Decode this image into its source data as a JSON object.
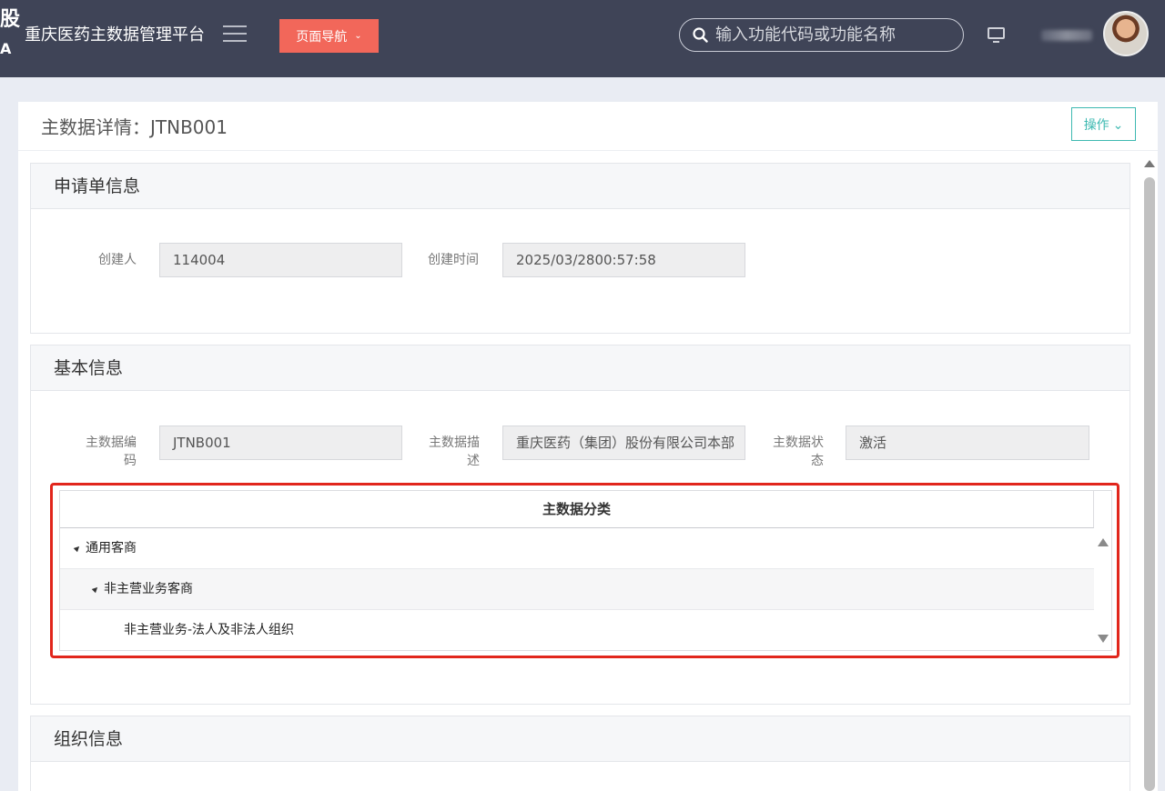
{
  "header": {
    "logo_top": "股",
    "logo_bottom": "A",
    "app_title": "重庆医药主数据管理平台",
    "nav_button_label": "页面导航",
    "search_placeholder": "输入功能代码或功能名称"
  },
  "page": {
    "title": "主数据详情：JTNB001",
    "action_button": "操作"
  },
  "sections": {
    "application": {
      "title": "申请单信息",
      "creator_label": "创建人",
      "creator_value": "114004",
      "created_time_label": "创建时间",
      "created_time_value": "2025/03/2800:57:58"
    },
    "basic": {
      "title": "基本信息",
      "code_label_line1": "主数据编",
      "code_label_line2": "码",
      "code_value": "JTNB001",
      "desc_label_line1": "主数据描",
      "desc_label_line2": "述",
      "desc_value": "重庆医药（集团）股份有限公司本部",
      "status_label_line1": "主数据状",
      "status_label_line2": "态",
      "status_value": "激活",
      "category_grid": {
        "header": "主数据分类",
        "rows": [
          {
            "label": "通用客商",
            "level": 0
          },
          {
            "label": "非主营业务客商",
            "level": 1
          },
          {
            "label": "非主营业务-法人及非法人组织",
            "level": 2
          }
        ]
      }
    },
    "organization": {
      "title": "组织信息"
    }
  },
  "colors": {
    "topbar": "#3f4457",
    "nav_button": "#f2675a",
    "accent": "#3db9b1",
    "highlight_border": "#e1261c"
  }
}
